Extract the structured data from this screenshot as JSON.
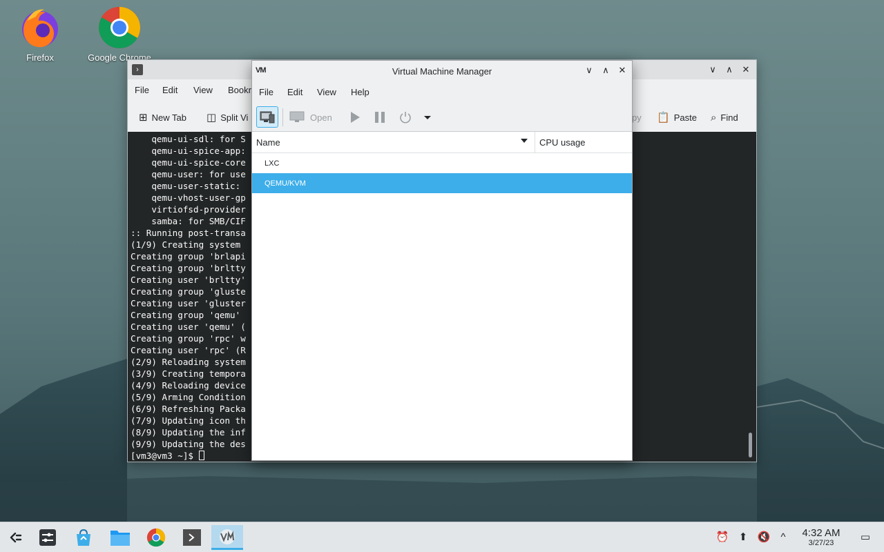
{
  "desktop": {
    "icons": [
      {
        "label": "Firefox",
        "icon": "firefox-icon"
      },
      {
        "label": "Google Chrome",
        "icon": "chrome-icon"
      }
    ]
  },
  "konsole": {
    "menu": [
      "File",
      "Edit",
      "View",
      "Bookr"
    ],
    "toolbar": {
      "new_tab": "New Tab",
      "split_view": "Split Vi",
      "copy_partial": "py",
      "paste": "Paste",
      "find": "Find"
    },
    "terminal_lines": [
      "    qemu-ui-sdl: for S",
      "    qemu-ui-spice-app:",
      "    qemu-ui-spice-core",
      "    qemu-user: for use",
      "    qemu-user-static: ",
      "    qemu-vhost-user-gp",
      "    virtiofsd-provider",
      "    samba: for SMB/CIF",
      ":: Running post-transa",
      "(1/9) Creating system ",
      "Creating group 'brlapi",
      "Creating group 'brltty",
      "Creating user 'brltty'",
      "Creating group 'gluste",
      "Creating user 'gluster",
      "Creating group 'qemu' ",
      "Creating user 'qemu' (",
      "Creating group 'rpc' w",
      "Creating user 'rpc' (R",
      "(2/9) Reloading system",
      "(3/9) Creating tempora",
      "(4/9) Reloading device",
      "(5/9) Arming Condition",
      "(6/9) Refreshing Packa",
      "(7/9) Updating icon th",
      "(8/9) Updating the inf",
      "(9/9) Updating the des"
    ],
    "prompt": "[vm3@vm3 ~]$ "
  },
  "vmm": {
    "title": "Virtual Machine Manager",
    "logo": "VM",
    "menu": [
      "File",
      "Edit",
      "View",
      "Help"
    ],
    "toolbar": {
      "open": "Open"
    },
    "columns": {
      "name": "Name",
      "cpu": "CPU usage"
    },
    "rows": [
      {
        "label": "LXC",
        "selected": false
      },
      {
        "label": "QEMU/KVM",
        "selected": true
      }
    ],
    "selection_color": "#3daee9"
  },
  "taskbar": {
    "clock_time": "4:32 AM",
    "clock_date": "3/27/23",
    "apps": [
      "app-launcher-icon",
      "system-settings-icon",
      "discover-store-icon",
      "file-manager-icon",
      "chrome-icon",
      "konsole-icon",
      "virt-manager-icon"
    ]
  }
}
